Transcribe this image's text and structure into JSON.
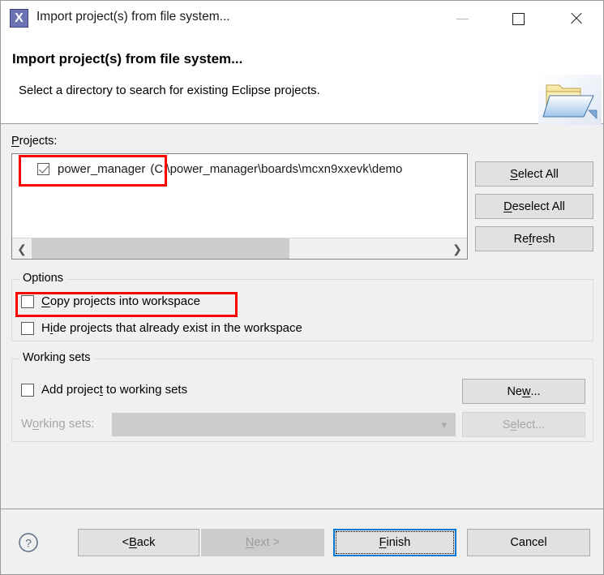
{
  "window": {
    "title": "Import project(s) from file system...",
    "app_icon": "eclipse-x-icon",
    "minimize_label": "minimize-icon",
    "maximize_label": "maximize-icon",
    "close_label": "close-icon"
  },
  "header": {
    "title": "Import project(s) from file system...",
    "subtitle": "Select a directory to search for existing Eclipse projects.",
    "icon": "open-folder-icon"
  },
  "projects": {
    "label": "Projects:",
    "rows": [
      {
        "name": "power_manager",
        "path_suffix": "(C:\\power_manager\\boards\\mcxn9xxevk\\demo",
        "checked": true
      }
    ],
    "buttons": [
      {
        "label": "Select All",
        "mnemonic": "S",
        "enabled": true
      },
      {
        "label": "Deselect All",
        "mnemonic": "D",
        "enabled": true
      },
      {
        "label": "Refresh",
        "mnemonic": "f",
        "enabled": true
      }
    ],
    "scrollbar": {
      "left_arrow": "chevron-left-icon",
      "right_arrow": "chevron-right-icon",
      "thumb_percent": 62
    }
  },
  "options": {
    "legend": "Options",
    "checkboxes": [
      {
        "label": "Copy projects into workspace",
        "mnemonic": "C",
        "checked": false
      },
      {
        "label": "Hide projects that already exist in the workspace",
        "mnemonic": "i",
        "checked": false
      }
    ]
  },
  "working_sets": {
    "legend": "Working sets",
    "add_checkbox": {
      "label": "Add project to working sets",
      "mnemonic": "t",
      "checked": false
    },
    "combo_label": "Working sets:",
    "combo_value": "",
    "combo_enabled": false,
    "new_button": {
      "label": "New...",
      "mnemonic": "w",
      "enabled": true
    },
    "select_button": {
      "label": "Select...",
      "mnemonic": "e",
      "enabled": false
    }
  },
  "footer": {
    "help_icon": "help-circle-icon",
    "buttons": [
      {
        "label": "< Back",
        "mnemonic": "B",
        "enabled": true,
        "focused": false
      },
      {
        "label": "Next >",
        "mnemonic": "N",
        "enabled": false,
        "focused": false
      },
      {
        "label": "Finish",
        "mnemonic": "F",
        "enabled": true,
        "focused": true
      },
      {
        "label": "Cancel",
        "mnemonic": "",
        "enabled": true,
        "focused": false
      }
    ]
  },
  "annotations": [
    {
      "name": "project-row-highlight",
      "color": "#ff0000"
    },
    {
      "name": "copy-projects-highlight",
      "color": "#ff0000"
    }
  ],
  "colors": {
    "accent": "#0078d7",
    "annotation": "#ff0000",
    "dialog_bg": "#f0f0f0",
    "button_bg": "#e1e1e1",
    "disabled_text": "#a6a6a6"
  }
}
